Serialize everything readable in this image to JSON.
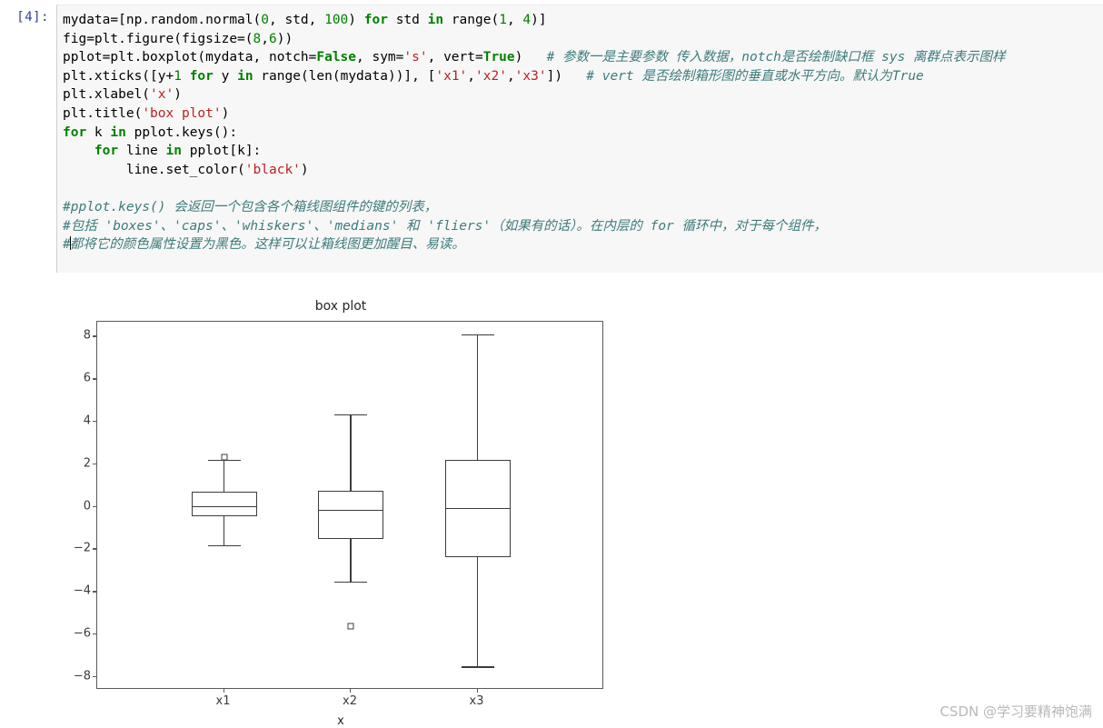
{
  "notebook": {
    "prompt": "In [4]:",
    "prompt_visible": "[4]:",
    "prompt_prefix": "n",
    "code_lines": [
      {
        "id": "line1",
        "tokens": [
          {
            "t": "mydata=[np.random.normal(",
            "c": "plain"
          },
          {
            "t": "0",
            "c": "num"
          },
          {
            "t": ", std, ",
            "c": "plain"
          },
          {
            "t": "100",
            "c": "num"
          },
          {
            "t": ") ",
            "c": "plain"
          },
          {
            "t": "for",
            "c": "kw"
          },
          {
            "t": " std ",
            "c": "plain"
          },
          {
            "t": "in",
            "c": "kw"
          },
          {
            "t": " range(",
            "c": "plain"
          },
          {
            "t": "1",
            "c": "num"
          },
          {
            "t": ", ",
            "c": "plain"
          },
          {
            "t": "4",
            "c": "num"
          },
          {
            "t": ")]",
            "c": "plain"
          }
        ]
      },
      {
        "id": "line2",
        "tokens": [
          {
            "t": "fig=plt.figure(figsize=(",
            "c": "plain"
          },
          {
            "t": "8",
            "c": "num"
          },
          {
            "t": ",",
            "c": "plain"
          },
          {
            "t": "6",
            "c": "num"
          },
          {
            "t": "))",
            "c": "plain"
          }
        ]
      },
      {
        "id": "line3",
        "tokens": [
          {
            "t": "pplot=plt.boxplot(mydata, notch=",
            "c": "plain"
          },
          {
            "t": "False",
            "c": "bool"
          },
          {
            "t": ", sym=",
            "c": "plain"
          },
          {
            "t": "'s'",
            "c": "str"
          },
          {
            "t": ", vert=",
            "c": "plain"
          },
          {
            "t": "True",
            "c": "bool"
          },
          {
            "t": ")   ",
            "c": "plain"
          },
          {
            "t": "# 参数一是主要参数 传入数据，notch是否绘制缺口框 sys 离群点表示图样",
            "c": "cmt"
          }
        ]
      },
      {
        "id": "line4",
        "tokens": [
          {
            "t": "plt.xticks([y+",
            "c": "plain"
          },
          {
            "t": "1",
            "c": "num"
          },
          {
            "t": " ",
            "c": "plain"
          },
          {
            "t": "for",
            "c": "kw"
          },
          {
            "t": " y ",
            "c": "plain"
          },
          {
            "t": "in",
            "c": "kw"
          },
          {
            "t": " range(len(mydata))], [",
            "c": "plain"
          },
          {
            "t": "'x1'",
            "c": "str"
          },
          {
            "t": ",",
            "c": "plain"
          },
          {
            "t": "'x2'",
            "c": "str"
          },
          {
            "t": ",",
            "c": "plain"
          },
          {
            "t": "'x3'",
            "c": "str"
          },
          {
            "t": "])   ",
            "c": "plain"
          },
          {
            "t": "# vert 是否绘制箱形图的垂直或水平方向。默认为True",
            "c": "cmt"
          }
        ]
      },
      {
        "id": "line5",
        "tokens": [
          {
            "t": "plt.xlabel(",
            "c": "plain"
          },
          {
            "t": "'x'",
            "c": "str"
          },
          {
            "t": ")",
            "c": "plain"
          }
        ]
      },
      {
        "id": "line6",
        "tokens": [
          {
            "t": "plt.title(",
            "c": "plain"
          },
          {
            "t": "'box plot'",
            "c": "str"
          },
          {
            "t": ")",
            "c": "plain"
          }
        ]
      },
      {
        "id": "line7",
        "tokens": [
          {
            "t": "for",
            "c": "kw"
          },
          {
            "t": " k ",
            "c": "plain"
          },
          {
            "t": "in",
            "c": "kw"
          },
          {
            "t": " pplot.keys():",
            "c": "plain"
          }
        ]
      },
      {
        "id": "line8",
        "tokens": [
          {
            "t": "    ",
            "c": "plain"
          },
          {
            "t": "for",
            "c": "kw"
          },
          {
            "t": " line ",
            "c": "plain"
          },
          {
            "t": "in",
            "c": "kw"
          },
          {
            "t": " pplot[k]:",
            "c": "plain"
          }
        ]
      },
      {
        "id": "line9",
        "tokens": [
          {
            "t": "        line.set_color(",
            "c": "plain"
          },
          {
            "t": "'black'",
            "c": "str"
          },
          {
            "t": ")",
            "c": "plain"
          }
        ]
      }
    ],
    "comment_lines": [
      "#pplot.keys() 会返回一个包含各个箱线图组件的键的列表，",
      "#包括 'boxes'、'caps'、'whiskers'、'medians' 和 'fliers'（如果有的话）。在内层的 for 循环中，对于每个组件，",
      "#都将它的颜色属性设置为黑色。这样可以让箱线图更加醒目、易读。"
    ],
    "colors": {
      "keyword": "#008000",
      "string": "#BA2121",
      "number": "#008000",
      "comment": "#3D7B7B",
      "cell_background": "#f7f7f7",
      "prompt": "#303F9F"
    }
  },
  "watermark": {
    "text": "CSDN @学习要精神饱满"
  },
  "chart_data": {
    "type": "box",
    "title": "box plot",
    "xlabel": "x",
    "ylabel": "",
    "categories": [
      "x1",
      "x2",
      "x3"
    ],
    "xtick_labels": [
      "x1",
      "x2",
      "x3"
    ],
    "ytick_labels": [
      "8",
      "6",
      "4",
      "2",
      "0",
      "-2",
      "-4",
      "-6",
      "-8"
    ],
    "ytick_values": [
      8,
      6,
      4,
      2,
      0,
      -2,
      -4,
      -6,
      -8
    ],
    "ylim": [
      -8.6,
      8.7
    ],
    "grid": false,
    "legend": null,
    "boxes": [
      {
        "name": "x1",
        "position": 1,
        "whisker_low": -1.8,
        "q1": -0.45,
        "median": 0.05,
        "q3": 0.7,
        "whisker_high": 2.2,
        "fliers": [
          2.35
        ]
      },
      {
        "name": "x2",
        "position": 2,
        "whisker_low": -3.5,
        "q1": -1.5,
        "median": -0.15,
        "q3": 0.75,
        "whisker_high": 4.35,
        "fliers": [
          -5.6
        ]
      },
      {
        "name": "x3",
        "position": 3,
        "whisker_low": -7.5,
        "q1": -2.35,
        "median": -0.05,
        "q3": 2.2,
        "whisker_high": 8.1,
        "fliers": []
      }
    ]
  }
}
